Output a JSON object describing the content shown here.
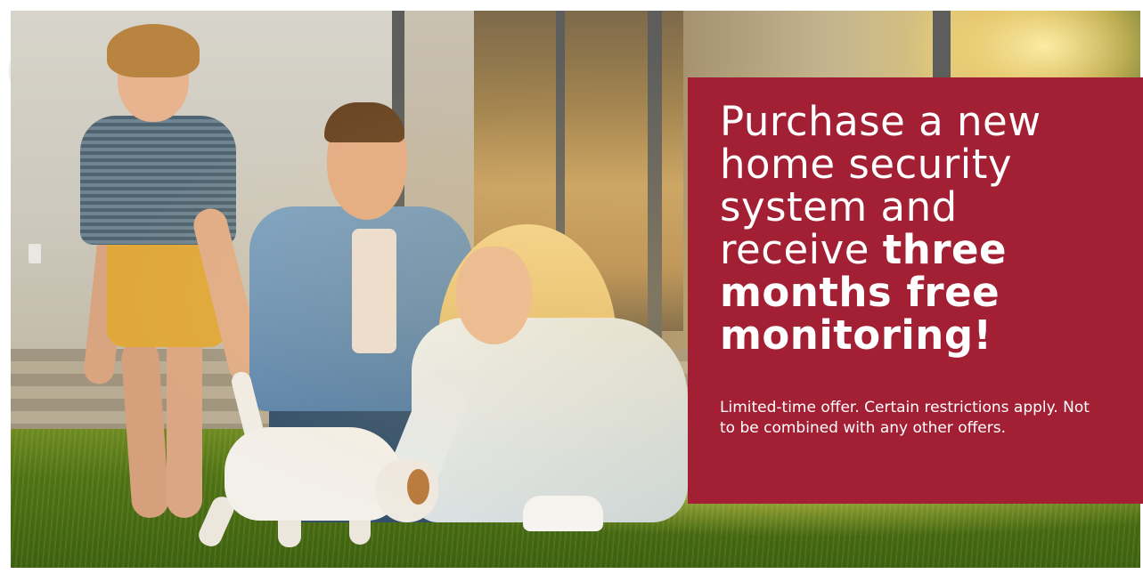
{
  "offer": {
    "headline_plain": "Purchase a new home security system and receive",
    "headline_bold": "three months free monitoring!",
    "disclaimer": "Limited-time offer. Certain restrictions apply. Not to be combined with any other offers."
  },
  "colors": {
    "panel_background": "#a32034",
    "panel_text": "#ffffff",
    "page_background": "#ffffff"
  },
  "image": {
    "subject": "hero-photo-family-playing-with-puppy"
  }
}
